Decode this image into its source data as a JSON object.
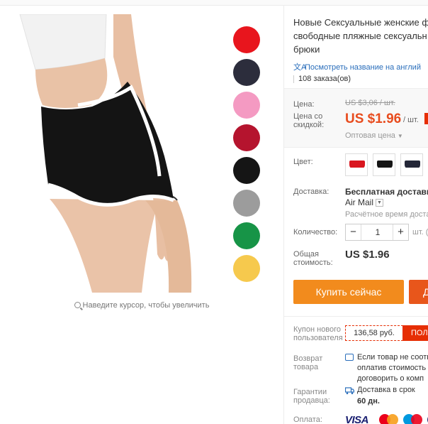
{
  "product": {
    "title_lines": [
      "Новые Сексуальные женские ф",
      "свободные пляжные сексуальн",
      "брюки"
    ],
    "translate_link": "Посмотреть название на англий",
    "orders": "108 заказа(ов)"
  },
  "gallery": {
    "zoom_hint": "Наведите курсор, чтобы увеличить",
    "swatch_colors": [
      "#e8151d",
      "#2c2d3c",
      "#f49ac2",
      "#b5142e",
      "#151515",
      "#9c9c9c",
      "#179447",
      "#f6c94d"
    ]
  },
  "price": {
    "price_label": "Цена:",
    "old_price": "US $3,06 / шт.",
    "discount_label_1": "Цена со",
    "discount_label_2": "скидкой:",
    "new_price": "US $1.96",
    "unit": "/ шт.",
    "wholesale": "Оптовая цена"
  },
  "options": {
    "color_label": "Цвет:",
    "color_thumbs": [
      {
        "color": "#d9161f"
      },
      {
        "color": "#151515"
      },
      {
        "color": "#232637"
      }
    ],
    "shipping_label": "Доставка:",
    "shipping_main": "Бесплатная доставка в",
    "shipping_method": "Air Mail",
    "shipping_estimate": "Расчётное время доставк",
    "quantity_label": "Количество:",
    "quantity_value": "1",
    "quantity_unit": "шт. (",
    "total_label_1": "Общая",
    "total_label_2": "стоимость:",
    "total_value": "US $1.96"
  },
  "actions": {
    "buy_now": "Купить сейчас",
    "add_to_cart": "Д"
  },
  "extras": {
    "coupon_label_1": "Купон нового",
    "coupon_label_2": "пользователя",
    "coupon_code": "136,58 руб.",
    "coupon_button": "ПОЛ",
    "return_label_1": "Возврат",
    "return_label_2": "товара",
    "return_lines": [
      "Если товар не соотве",
      "оплатив стоимость о",
      "договорить о комп"
    ],
    "guarantee_label_1": "Гарантии",
    "guarantee_label_2": "продавца:",
    "guarantee_text": "Доставка в срок",
    "guarantee_days": "60 дн.",
    "payment_label": "Оплата:",
    "visa": "VISA"
  }
}
